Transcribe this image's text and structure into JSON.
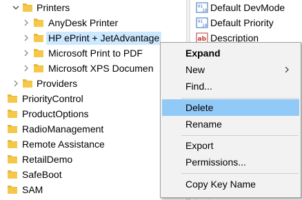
{
  "tree": {
    "items": [
      {
        "label": "Printers",
        "level": 1,
        "expanded": true
      },
      {
        "label": "AnyDesk Printer",
        "level": 2
      },
      {
        "label": "HP ePrint + JetAdvantage",
        "level": 2,
        "selected": true
      },
      {
        "label": "Microsoft Print to PDF",
        "level": 2
      },
      {
        "label": "Microsoft XPS Documen",
        "level": 2
      },
      {
        "label": "Providers",
        "level": 1
      },
      {
        "label": "PriorityControl",
        "level": 0
      },
      {
        "label": "ProductOptions",
        "level": 0
      },
      {
        "label": "RadioManagement",
        "level": 0
      },
      {
        "label": "Remote Assistance",
        "level": 0
      },
      {
        "label": "RetailDemo",
        "level": 0
      },
      {
        "label": "SafeBoot",
        "level": 0
      },
      {
        "label": "SAM",
        "level": 0
      }
    ]
  },
  "values": {
    "items": [
      {
        "label": "Default DevMode",
        "icon": "binary-value-icon"
      },
      {
        "label": "Default Priority",
        "icon": "binary-value-icon"
      },
      {
        "label": "Description",
        "icon": "string-value-icon"
      }
    ]
  },
  "context_menu": {
    "items": [
      {
        "label": "Expand",
        "bold": true
      },
      {
        "label": "New",
        "submenu": true
      },
      {
        "label": "Find..."
      },
      {
        "separator": true
      },
      {
        "label": "Delete",
        "highlighted": true
      },
      {
        "label": "Rename"
      },
      {
        "separator": true
      },
      {
        "label": "Export"
      },
      {
        "label": "Permissions..."
      },
      {
        "separator": true
      },
      {
        "label": "Copy Key Name"
      }
    ]
  },
  "colors": {
    "folder": "#e8b73a",
    "folder_dark": "#d9a22b",
    "selection": "#cce8ff",
    "menu_highlight": "#91c9f7",
    "menu_bg": "#f2f2f2"
  }
}
